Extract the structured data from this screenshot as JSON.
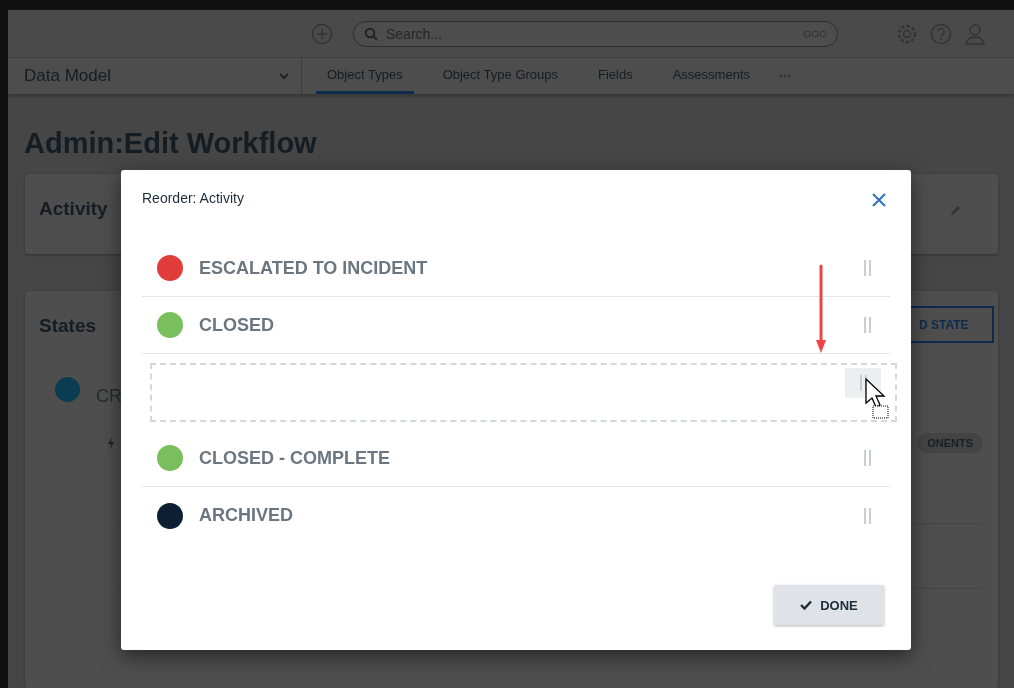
{
  "top_bar": {
    "search": {
      "placeholder": "Search..."
    }
  },
  "nav": {
    "menu": "Data Model",
    "tabs": [
      {
        "label": "Object Types",
        "selected": true
      },
      {
        "label": "Object Type Groups",
        "selected": false
      },
      {
        "label": "Fields",
        "selected": false
      },
      {
        "label": "Assessments",
        "selected": false
      }
    ]
  },
  "page_title": "Admin:Edit Workflow",
  "activity_card": {
    "title": "Activity"
  },
  "states_card": {
    "title": "States",
    "add_button": "D STATE",
    "state": {
      "name": "CR",
      "color": "#0a3c52"
    },
    "badge": "ONENTS"
  },
  "modal": {
    "title": "Reorder: Activity",
    "states_above": [
      {
        "name": "ESCALATED TO INCIDENT",
        "color": "#e03c3c"
      },
      {
        "name": "CLOSED",
        "color": "#7abf5e"
      }
    ],
    "states_below": [
      {
        "name": "CLOSED - COMPLETE",
        "color": "#7abf5e"
      },
      {
        "name": "ARCHIVED",
        "color": "#0c1f33"
      }
    ],
    "done_button": "DONE"
  }
}
